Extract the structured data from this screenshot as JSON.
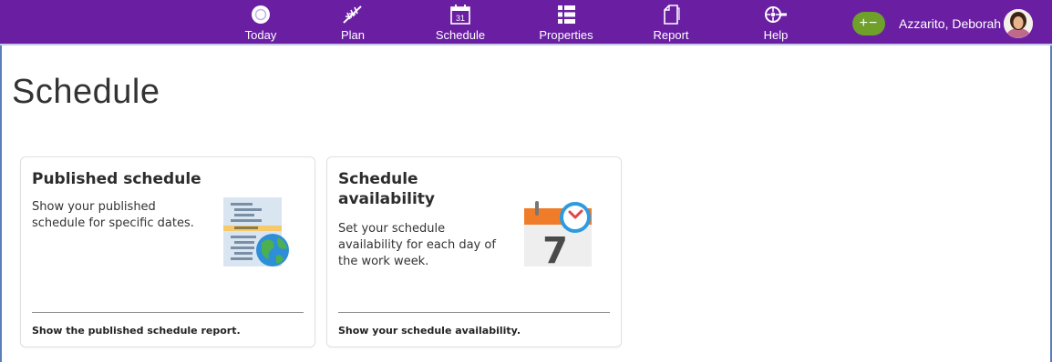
{
  "nav": {
    "items": [
      {
        "label": "Today",
        "icon": "today-icon"
      },
      {
        "label": "Plan",
        "icon": "plan-icon"
      },
      {
        "label": "Schedule",
        "icon": "calendar-icon",
        "icon_text": "31"
      },
      {
        "label": "Properties",
        "icon": "properties-list-icon"
      },
      {
        "label": "Report",
        "icon": "report-icon"
      },
      {
        "label": "Help",
        "icon": "help-icon"
      }
    ],
    "toggle_badge": "+−",
    "user_name": "Azzarito, Deborah"
  },
  "page": {
    "title": "Schedule"
  },
  "cards": [
    {
      "title": "Published schedule",
      "description": "Show your published schedule for specific dates.",
      "link": "Show the published schedule report.",
      "icon": "published-schedule-globe-icon"
    },
    {
      "title": "Schedule availability",
      "description": "Set your schedule availability for each day of the work week.",
      "link": "Show your schedule availability.",
      "icon": "calendar-clock-icon",
      "icon_text": "7"
    }
  ],
  "colors": {
    "topbar": "#6a1fa3",
    "toggle_badge": "#6ea02a",
    "calendar_orange": "#f07c2a",
    "clock_blue": "#2e9be0",
    "globe_green": "#4caf50"
  }
}
